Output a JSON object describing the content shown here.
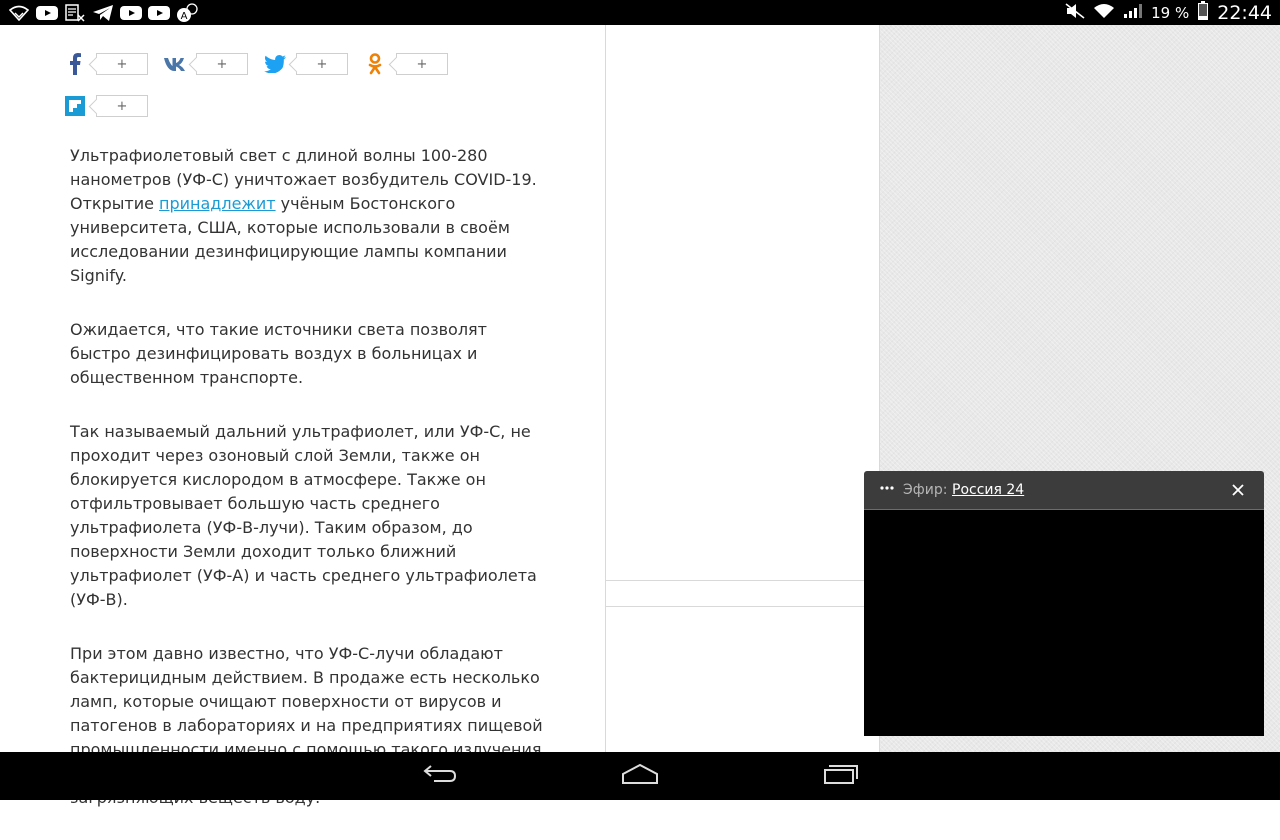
{
  "status_bar": {
    "left_icons": [
      "wifi-plus-icon",
      "youtube-icon",
      "document-icon",
      "telegram-icon",
      "youtube-icon",
      "youtube-icon",
      "accessibility-icon"
    ],
    "battery": "19 %",
    "time": "22:44"
  },
  "share": {
    "buttons": [
      {
        "network": "facebook",
        "icon": "facebook-icon",
        "count": "+"
      },
      {
        "network": "vk",
        "icon": "vk-icon",
        "count": "+"
      },
      {
        "network": "twitter",
        "icon": "twitter-icon",
        "count": "+"
      },
      {
        "network": "odnoklassniki",
        "icon": "odnoklassniki-icon",
        "count": "+"
      },
      {
        "network": "flipboard",
        "icon": "flipboard-icon",
        "count": "+"
      }
    ]
  },
  "article": {
    "p1_before": "Ультрафиолетовый свет с длиной волны 100-280 нанометров (УФ-С) уничтожает возбудитель COVID-19. Открытие ",
    "p1_link": "принадлежит",
    "p1_after": " учёным Бостонского университета, США, которые использовали в своём исследовании дезинфицирующие лампы компании Signify.",
    "p2": "Ожидается, что такие источники света позволят быстро дезинфицировать воздух в больницах и общественном транспорте.",
    "p3": "Так называемый дальний ультрафиолет, или УФ-С, не проходит через озоновый слой Земли, также он блокируется кислородом в атмосфере. Также он отфильтровывает большую часть среднего ультрафиолета (УФ-В-лучи). Таким образом, до поверхности Земли доходит только ближний ультрафиолет (УФ-А) и часть среднего ультрафиолета (УФ-В).",
    "p4": "При этом давно известно, что УФ-С-лучи обладают бактерицидным действием. В продаже есть несколько ламп, которые очищают поверхности от вирусов и патогенов в лабораториях и на предприятиях пищевой промышленности именно с помощью такого излучения. Также такой свет избавляет от органических загрязняющих веществ воду."
  },
  "player": {
    "label": "Эфир:",
    "channel": "Россия 24"
  },
  "colors": {
    "link": "#1a9bd6",
    "facebook": "#3b5998",
    "vk": "#4a76a8",
    "twitter": "#1da1f2",
    "odnoklassniki": "#ee8208",
    "flipboard": "#1a9bd6",
    "player_accent": "#2a7ad8"
  }
}
